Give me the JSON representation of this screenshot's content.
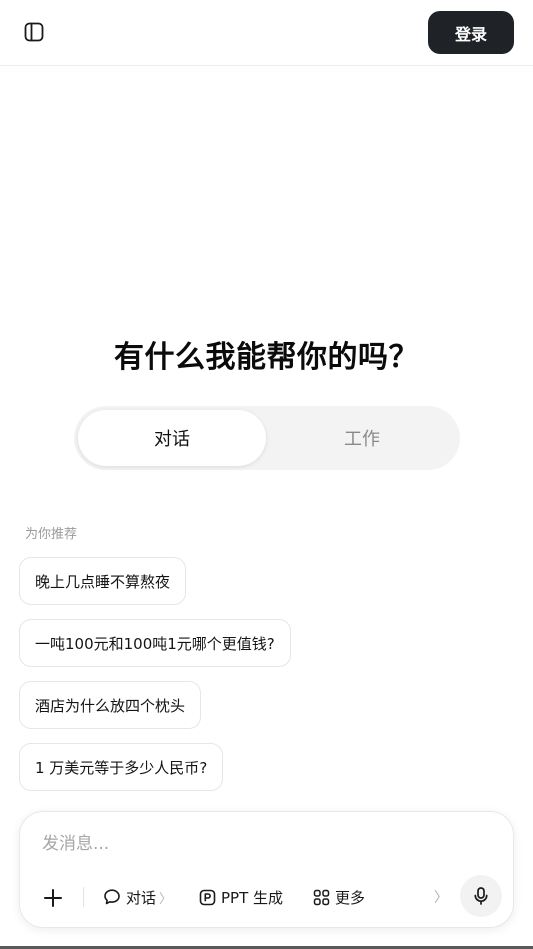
{
  "header": {
    "sidebar_toggle_icon": "sidebar-toggle-icon",
    "login_label": "登录"
  },
  "hero": {
    "title": "有什么我能帮你的吗？"
  },
  "mode_switch": {
    "tabs": [
      {
        "label": "对话",
        "active": true
      },
      {
        "label": "工作",
        "active": false
      }
    ]
  },
  "recommendations": {
    "label": "为你推荐",
    "items": [
      "晚上几点睡不算熬夜",
      "一吨100元和100吨1元哪个更值钱?",
      "酒店为什么放四个枕头",
      "1 万美元等于多少人民币?"
    ]
  },
  "composer": {
    "placeholder": "发消息...",
    "tools": [
      {
        "icon": "chat-bubble-icon",
        "label": "对话",
        "chevron": "〉"
      },
      {
        "icon": "ppt-icon",
        "label": "PPT 生成"
      },
      {
        "icon": "grid-icon",
        "label": "更多"
      }
    ],
    "scroll_chevron": "〉",
    "mic_icon": "microphone-icon"
  },
  "colors": {
    "login_button_bg": "#1f2226",
    "mode_switch_bg": "#f3f3f4",
    "inactive_tab_text": "#8a8a8a"
  }
}
